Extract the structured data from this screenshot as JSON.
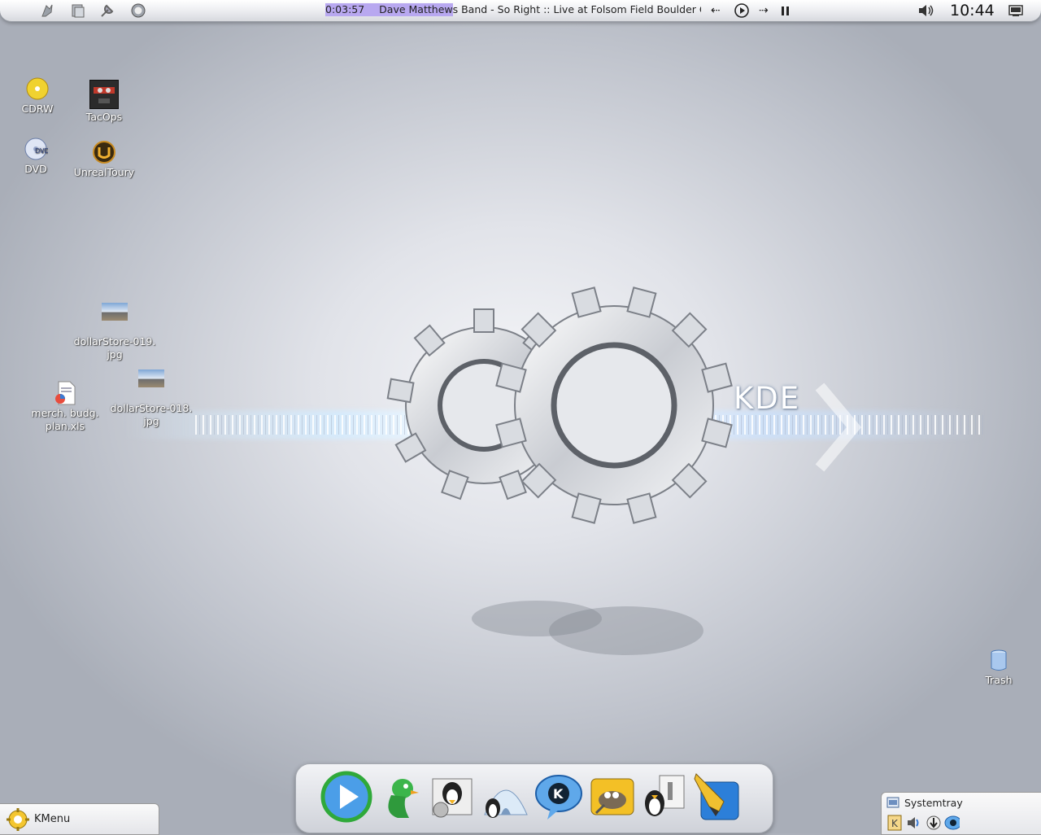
{
  "top_panel": {
    "now_playing": {
      "elapsed": "0:03:57",
      "title": "Dave Matthews Band - So Right :: Live at Folsom Field Boulder Colorado",
      "progress_fraction": 0.34
    },
    "controls": {
      "prev": "⇠",
      "next": "⇢"
    },
    "clock": "10:44"
  },
  "desktop_icons": {
    "cdrw": "CDRW",
    "tacops": "TacOps",
    "dvd": "DVD",
    "unreal": "UnrealToury",
    "dollar19": "dollarStore-019.\njpg",
    "merch": "merch. budg.\nplan.xls",
    "dollar18": "dollarStore-018.\njpg",
    "trash": "Trash"
  },
  "logo": {
    "text": "KDE"
  },
  "kmenu": {
    "label": "KMenu"
  },
  "systray": {
    "label": "Systemtray"
  },
  "colors": {
    "progress": "#b8a8f0",
    "desktop_text": "#ffffff"
  }
}
